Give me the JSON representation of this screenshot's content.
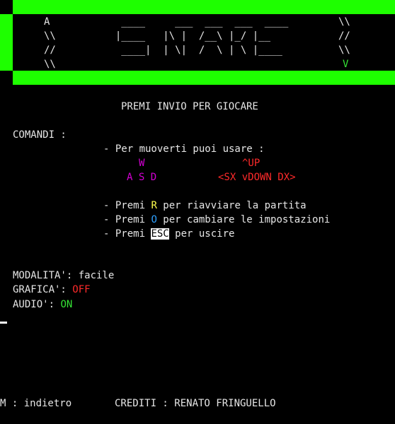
{
  "banner": {
    "rows": [
      {
        "left": "A ",
        "art": "   ____     ___  ___  ___  ____ ",
        "right": "\\\\"
      },
      {
        "left": "\\\\",
        "art": "  |____   |\\ |  /__\\ |_/ |__   ",
        "right": "//"
      },
      {
        "left": "//",
        "art": "   ____|  | \\|  /  \\ | \\ |____ ",
        "right": "\\\\"
      },
      {
        "left": "\\\\",
        "art": "",
        "right": "V"
      }
    ]
  },
  "prompt": "PREMI INVIO PER GIOCARE",
  "commands": {
    "title": "COMANDI :",
    "move_intro": "- Per muoverti puoi usare :",
    "key_w": "W",
    "key_up": "^UP",
    "keys_asd": "A S D",
    "keys_arrows": "<SX vDOWN DX>",
    "restart_prefix": "- Premi ",
    "restart_key": "R",
    "restart_suffix": " per riavviare la partita",
    "settings_prefix": "- Premi ",
    "settings_key": "O",
    "settings_suffix": " per cambiare le impostazioni",
    "exit_prefix": "- Premi ",
    "exit_key": "ESC",
    "exit_suffix": " per uscire"
  },
  "settings": {
    "mode_label": "MODALITA': ",
    "mode_value": "facile",
    "graphics_label": "GRAFICA': ",
    "graphics_value": "OFF",
    "audio_label": "AUDIO': ",
    "audio_value": "ON"
  },
  "footer": {
    "back": "M : indietro",
    "credits": "CREDITI : RENATO FRINGUELLO"
  },
  "colors": {
    "border": "#1eff00",
    "background": "#000000",
    "magenta": "#d400d4",
    "red": "#ff2a2a",
    "yellow": "#ffff4d",
    "cyan": "#2ea0ff",
    "green": "#35e335"
  }
}
